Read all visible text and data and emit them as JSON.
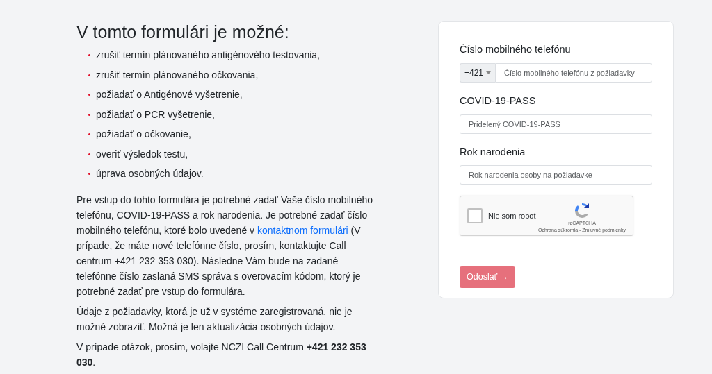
{
  "heading": "V tomto formulári je možné:",
  "options": [
    "zrušiť termín plánovaného antigénového testovania,",
    "zrušiť termín plánovaného očkovania,",
    "požiadať o Antigénové vyšetrenie,",
    "požiadať o PCR vyšetrenie,",
    "požiadať o očkovanie,",
    "overiť výsledok testu,",
    "úprava osobných údajov."
  ],
  "paragraphs": [
    {
      "parts": [
        {
          "kind": "text",
          "text": "Pre vstup do tohto formulára je potrebné zadať Vaše číslo mobilného telefónu, COVID-19-PASS a rok narodenia. Je potrebné zadať číslo mobilného telefónu, ktoré bolo uvedené v "
        },
        {
          "kind": "link",
          "text": "kontaktnom formulári"
        },
        {
          "kind": "text",
          "text": " (V prípade, že máte nové telefónne číslo, prosím, kontaktujte Call centrum +421 232 353 030). Následne Vám bude na zadané telefónne číslo zaslaná SMS správa s overovacím kódom, ktorý je potrebné zadať pre vstup do formulára."
        }
      ]
    },
    {
      "parts": [
        {
          "kind": "text",
          "text": "Údaje z požiadavky, ktorá je už v systéme zaregistrovaná, nie je možné zobraziť. Možná je len aktualizácia osobných údajov."
        }
      ]
    },
    {
      "parts": [
        {
          "kind": "text",
          "text": "V prípade otázok, prosím, volajte NCZI Call Centrum **+421 232 353 030**."
        }
      ]
    }
  ],
  "form": {
    "fields": [
      {
        "kind": "phone",
        "label": "Číslo mobilného telefónu",
        "prefix": "+421",
        "placeholder": "Číslo mobilného telefónu z požiadavky"
      },
      {
        "kind": "text",
        "label": "COVID-19-PASS",
        "placeholder": "Pridelený COVID-19-PASS"
      },
      {
        "kind": "text",
        "label": "Rok narodenia",
        "placeholder": "Rok narodenia osoby na požiadavke"
      }
    ],
    "captcha": {
      "label": "Nie som robot",
      "checked": false,
      "brand": "reCAPTCHA",
      "links": "Ochrana súkromia - Zmluvné podmienky"
    },
    "submit": {
      "label": "Odoslať",
      "arrow": "→",
      "disabled": true
    }
  }
}
